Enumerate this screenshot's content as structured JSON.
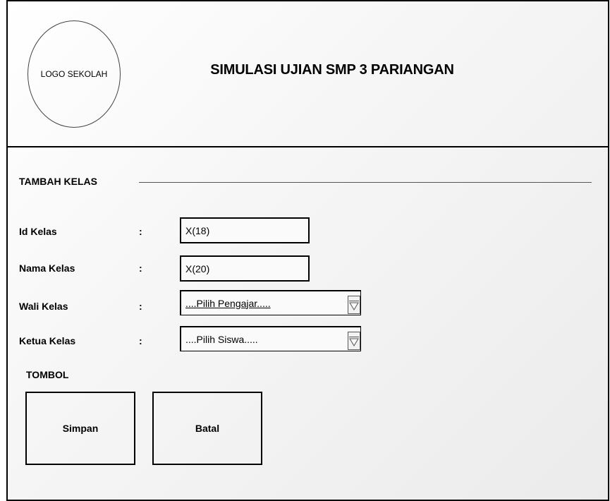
{
  "header": {
    "logo_text": "LOGO SEKOLAH",
    "title": "SIMULASI UJIAN SMP 3 PARIANGAN"
  },
  "form": {
    "section_title": "TAMBAH KELAS",
    "fields": [
      {
        "label": "Id Kelas",
        "colon": ":",
        "value": "X(18)"
      },
      {
        "label": "Nama Kelas",
        "colon": ":",
        "value": "X(20)"
      },
      {
        "label": "Wali Kelas",
        "colon": ":",
        "value": "....Pilih Pengajar....."
      },
      {
        "label": "Ketua Kelas",
        "colon": ":",
        "value": "....Pilih Siswa....."
      }
    ]
  },
  "buttons": {
    "section_title": "TOMBOL",
    "save_label": "Simpan",
    "cancel_label": "Batal"
  },
  "icons": {
    "dropdown": "chevron-down-icon"
  }
}
